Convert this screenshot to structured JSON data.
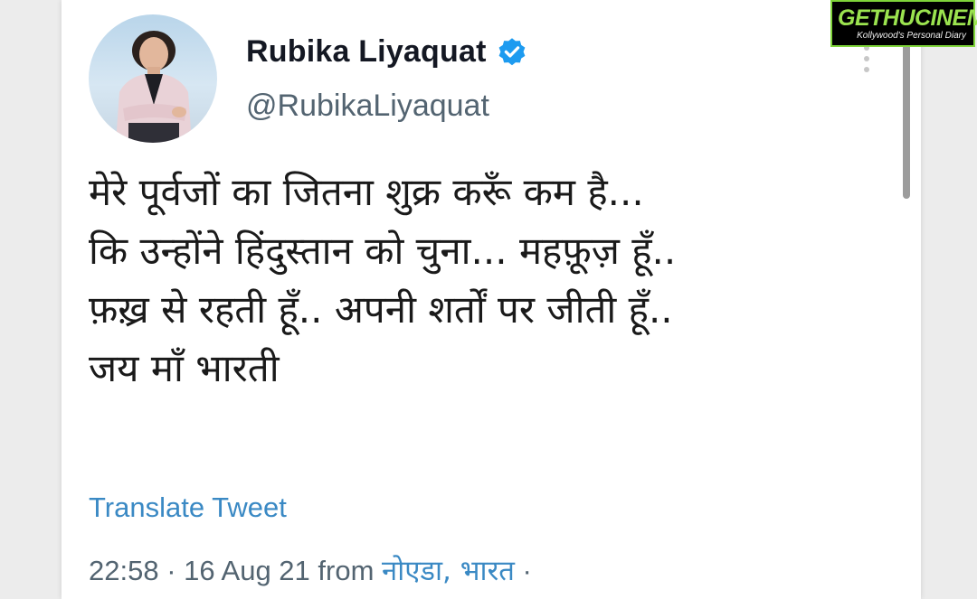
{
  "tweet": {
    "author_name": "Rubika Liyaquat",
    "handle": "@RubikaLiyaquat",
    "verified": true,
    "text_lines": [
      "मेरे पूर्वजों का जितना शुक्र करूँ कम है...",
      "कि उन्होंने हिंदुस्तान को चुना... महफ़ूज़ हूँ..",
      "फ़ख़्र से रहती हूँ.. अपनी शर्तों पर जीती हूँ..",
      "जय माँ भारती"
    ],
    "translate_label": "Translate Tweet",
    "time": "22:58",
    "separator": "·",
    "date": "16 Aug 21",
    "from_label": "from",
    "location": "नोएडा, भारत",
    "trailing_separator": "·"
  },
  "watermark": {
    "brand": "GETHUCINEMA",
    "tagline": "Kollywood's Personal Diary"
  },
  "colors": {
    "link_blue": "#3a89c4",
    "verified_blue": "#1d9bf0",
    "secondary_text": "#536471",
    "primary_text": "#141823",
    "watermark_green": "#9be34f"
  },
  "icons": [
    "verified-badge-icon",
    "more-options-icon"
  ]
}
